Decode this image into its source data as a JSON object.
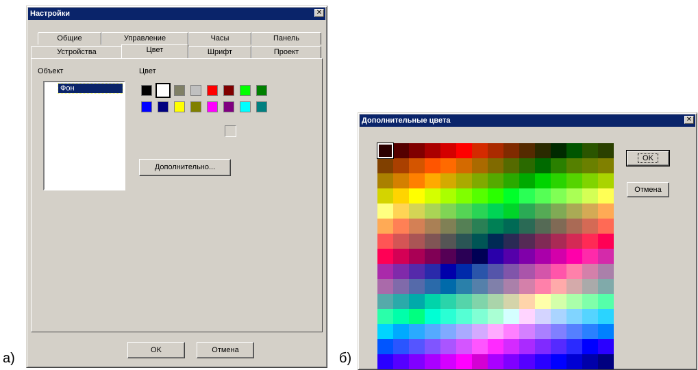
{
  "captions": {
    "a": "а)",
    "b": "б)"
  },
  "settings_dialog": {
    "title": "Настройки",
    "tabs_row1": [
      "Общие",
      "Управление",
      "Часы",
      "Панель"
    ],
    "tabs_row2": [
      "Устройства",
      "Цвет",
      "Шрифт",
      "Проект"
    ],
    "active_tab": "Цвет",
    "object_label": "Объект",
    "object_items": [
      "Фон"
    ],
    "selected_object": "Фон",
    "color_label": "Цвет",
    "swatches_row1": [
      "#000000",
      "#ffffff",
      "#808066",
      "#c0c0c0",
      "#ff0000",
      "#800000",
      "#00ff00",
      "#008000"
    ],
    "swatches_row2": [
      "#0000ff",
      "#000080",
      "#ffff00",
      "#808000",
      "#ff00ff",
      "#800080",
      "#00ffff",
      "#008080"
    ],
    "selected_swatch": "#ffffff",
    "more_button": "Дополнительно...",
    "ok_button": "OK",
    "cancel_button": "Отмена"
  },
  "extra_colors_dialog": {
    "title": "Дополнительные цвета",
    "ok_button": "OK",
    "cancel_button": "Отмена",
    "selected_color": "#2a0000",
    "palette_rows": [
      [
        "#2a0000",
        "#550000",
        "#800000",
        "#aa0000",
        "#d40000",
        "#ff0000",
        "#d42a00",
        "#aa2a00",
        "#802a00",
        "#552a00",
        "#2a2a00",
        "#002a00",
        "#005500",
        "#2a5500",
        "#2a4000"
      ],
      [
        "#804000",
        "#aa4000",
        "#d45500",
        "#ff5500",
        "#ff6a00",
        "#d46a00",
        "#aa6a00",
        "#806a00",
        "#556a00",
        "#2a6a00",
        "#006a00",
        "#2a8000",
        "#558000",
        "#6a8000",
        "#808000"
      ],
      [
        "#aa8000",
        "#d48000",
        "#ff8000",
        "#ffaa00",
        "#d4aa00",
        "#aaaa00",
        "#80aa00",
        "#55aa00",
        "#2aaa00",
        "#00aa00",
        "#00d400",
        "#2ad400",
        "#55d400",
        "#80d400",
        "#aad400"
      ],
      [
        "#d4d400",
        "#ffd400",
        "#ffff00",
        "#d4ff00",
        "#aaff00",
        "#80ff00",
        "#55ff00",
        "#2aff00",
        "#00ff2a",
        "#2aff55",
        "#55ff55",
        "#80ff55",
        "#aaff55",
        "#d4ff55",
        "#ffff55"
      ],
      [
        "#ffff80",
        "#ffd455",
        "#d4d455",
        "#aad455",
        "#80d455",
        "#55d455",
        "#2ad455",
        "#00d455",
        "#00d42a",
        "#2aaa55",
        "#55aa55",
        "#80aa55",
        "#aaaa55",
        "#d4aa55",
        "#ffaa55"
      ],
      [
        "#ffaa55",
        "#ff8055",
        "#d48055",
        "#aa8055",
        "#808055",
        "#558055",
        "#2a8055",
        "#008055",
        "#006a55",
        "#2a6a55",
        "#556a55",
        "#806a55",
        "#aa6a55",
        "#d46a55",
        "#ff6a55"
      ],
      [
        "#ff5555",
        "#d45555",
        "#aa5555",
        "#805555",
        "#555555",
        "#2a5555",
        "#005555",
        "#002a55",
        "#2a2a55",
        "#552a55",
        "#802a55",
        "#aa2a55",
        "#d42a55",
        "#ff2a55",
        "#ff0055"
      ],
      [
        "#ff0055",
        "#d40055",
        "#aa0055",
        "#800055",
        "#550055",
        "#2a0055",
        "#000055",
        "#2a00aa",
        "#5500aa",
        "#8000aa",
        "#aa00aa",
        "#d400aa",
        "#ff00aa",
        "#ff2aaa",
        "#d42aaa"
      ],
      [
        "#aa2aaa",
        "#802aaa",
        "#552aaa",
        "#2a2aaa",
        "#0000aa",
        "#002aaa",
        "#2a55aa",
        "#5555aa",
        "#8055aa",
        "#aa55aa",
        "#d455aa",
        "#ff55aa",
        "#ff80aa",
        "#d480aa",
        "#aa80aa"
      ],
      [
        "#aa6aaa",
        "#806aaa",
        "#556aaa",
        "#2a6aaa",
        "#006aaa",
        "#2a80aa",
        "#5580aa",
        "#8080aa",
        "#aa80aa",
        "#d480aa",
        "#ff80aa",
        "#ffaaaa",
        "#d4aaaa",
        "#aaaaaa",
        "#80aaaa"
      ],
      [
        "#55aaaa",
        "#2aaaaa",
        "#00aaaa",
        "#00d4aa",
        "#2ad4aa",
        "#55d4aa",
        "#80d4aa",
        "#aad4aa",
        "#d4d4aa",
        "#ffd4aa",
        "#ffffaa",
        "#d4ffaa",
        "#aaffaa",
        "#80ffaa",
        "#55ffaa"
      ],
      [
        "#2affaa",
        "#00ffaa",
        "#00ff80",
        "#00ffd4",
        "#2affd4",
        "#55ffd4",
        "#80ffd4",
        "#aaffd4",
        "#d4ffff",
        "#ffd4ff",
        "#d4d4ff",
        "#aad4ff",
        "#80d4ff",
        "#55d4ff",
        "#2ad4ff"
      ],
      [
        "#00d4ff",
        "#00aaff",
        "#2aaaff",
        "#55aaff",
        "#80aaff",
        "#aaaaff",
        "#d4aaff",
        "#ffaaff",
        "#ff80ff",
        "#d480ff",
        "#aa80ff",
        "#8080ff",
        "#5580ff",
        "#2a80ff",
        "#0080ff"
      ],
      [
        "#0055ff",
        "#2a55ff",
        "#5555ff",
        "#8055ff",
        "#aa55ff",
        "#d455ff",
        "#ff55ff",
        "#ff2aff",
        "#d42aff",
        "#aa2aff",
        "#802aff",
        "#552aff",
        "#2a2aff",
        "#0000ff",
        "#2a00ff"
      ],
      [
        "#2a00ff",
        "#5500ff",
        "#8000ff",
        "#aa00ff",
        "#d400ff",
        "#ff00ff",
        "#d400d4",
        "#aa00ff",
        "#8000ff",
        "#5500ff",
        "#2a00ff",
        "#0000ff",
        "#0000d4",
        "#0000aa",
        "#000080"
      ]
    ]
  }
}
